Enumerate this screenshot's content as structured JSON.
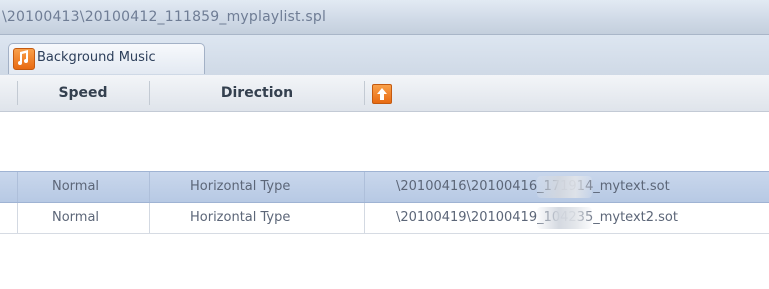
{
  "path_bar": {
    "text": "\\20100413\\20100412_111859_myplaylist.spl"
  },
  "tab": {
    "label": "Background Music",
    "icon": "music-note-icon"
  },
  "header": {
    "speed_label": "Speed",
    "direction_label": "Direction",
    "sort_icon": "sort-arrow-icon"
  },
  "rows": [
    {
      "speed": "Normal",
      "direction": "Horizontal Type",
      "file": "\\20100416\\20100416_171914_mytext.sot",
      "selected": true
    },
    {
      "speed": "Normal",
      "direction": "Horizontal Type",
      "file": "\\20100419\\20100419_104235_mytext2.sot",
      "selected": false
    }
  ],
  "colors": {
    "accent": "#e86a12",
    "selection": "#b7c9e4"
  }
}
